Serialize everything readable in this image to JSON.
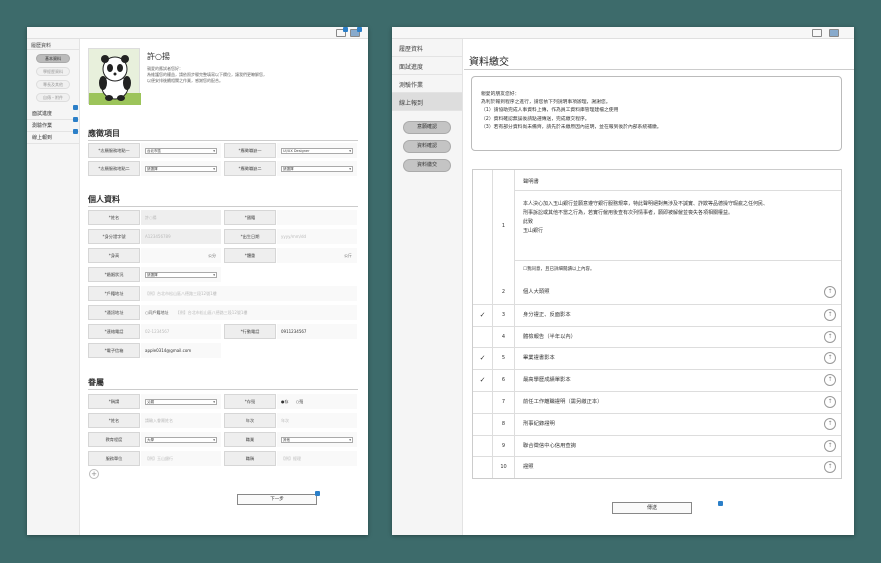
{
  "left": {
    "sidebar": {
      "header": "履歷資料",
      "pills": [
        "基本資料",
        "學經歷資料",
        "專長及其他",
        "自傳・附件"
      ],
      "nav": [
        "面試進度",
        "測驗作業",
        "線上報到"
      ]
    },
    "profile": {
      "name": "許○揚",
      "intro": [
        "親愛的應試者您好：",
        "為維護您的權益，請依照步驟完整填寫以下欄位，讓我們更瞭解您，",
        "以便安排後續相關之作業，感謝您的配合。"
      ]
    },
    "section_jobs": "應徵項目",
    "jobs": [
      {
        "label": "*志願服務地點一",
        "value": "台北市區"
      },
      {
        "label": "*應徵職缺一",
        "value": "UI/UX Designer"
      },
      {
        "label": "*志願服務地點二",
        "value": "請選擇"
      },
      {
        "label": "*應徵職缺二",
        "value": "請選擇"
      }
    ],
    "section_personal": "個人資料",
    "personal": {
      "name_label": "*姓名",
      "name_value": "許○揚",
      "nationality_label": "*國籍",
      "nationality_value": "",
      "id_label": "*身分證字號",
      "id_value": "A123456789",
      "birth_label": "*出生日期",
      "birth_value": "yyyy/mm/dd",
      "height_label": "*身高",
      "height_unit": "公分",
      "weight_label": "*體重",
      "weight_unit": "公斤",
      "marital_label": "*婚姻狀況",
      "marital_value": "請選擇",
      "reg_addr_label": "*戶籍地址",
      "reg_addr_value": "【例】台北市松山區八德路三段12號1樓",
      "mail_addr_label": "*通訊地址",
      "mail_addr_same": "○同戶籍地址",
      "mail_addr_value": "【例】台北市松山區八德路三段12號1樓",
      "phone_label": "*連絡電話",
      "phone_value": "02-1234567",
      "mobile_label": "*行動電話",
      "mobile_value": "0911234567",
      "email_label": "*電子信箱",
      "email_value": "apple0314@gmail.com"
    },
    "section_family": "眷屬",
    "family": {
      "relation_label": "*稱謂",
      "relation_value": "父親",
      "alive_label": "*存歿",
      "alive_yes": "●存",
      "alive_no": "○歿",
      "name_label": "*姓名",
      "name_value": "請輸入眷屬姓名",
      "age_label": "年次",
      "age_value": "年次",
      "edu_label": "教育程度",
      "edu_value": "大學",
      "job_label": "職業",
      "job_value": "其他",
      "company_label": "服務單位",
      "company_value": "【例】玉山銀行",
      "title_label": "職稱",
      "title_value": "【例】經理"
    },
    "add_icon": "+",
    "next_button": "下一步"
  },
  "right": {
    "sidebar": {
      "nav": [
        "履歷資料",
        "面試進度",
        "測驗作業",
        "線上報到"
      ],
      "pills": [
        "意願確認",
        "資料確認",
        "資料繳交"
      ]
    },
    "title": "資料繳交",
    "notice": [
      "親愛的朋友您好：",
      "為利於報到程序之進行，請您依下列說明事項辦理，謝謝您。",
      "（1）請協助完成人事資料上傳，作為員工資料庫管理建檔之使用",
      "（2）資料確認無誤後請點選傳送，完成繳交程序。",
      "（3）若有部分資料尚未備齊，請先於未繳原因內註明，並在報到後於內部系統補繳。"
    ],
    "declaration": {
      "num": "1",
      "title": "聲明書",
      "body": [
        "本人決心加入玉山銀行並願意遵守銀行服務規章，特此聲明絕對無涉及不誠實、詐欺等品德操守瑕疵之任何民、",
        "刑事訴訟或其他不當之行為，若實行僱用後查有次列情事者，願即被解僱並喪失各項相關權益。"
      ],
      "closing": "此致",
      "to": "玉山銀行",
      "agree": "☐我同意，且已詳細閱讀以上內容。"
    },
    "items": [
      {
        "num": "2",
        "text": "個人大頭照",
        "check": ""
      },
      {
        "num": "3",
        "text": "身分證正、反面影本",
        "check": "✓"
      },
      {
        "num": "4",
        "text": "體檢報告（半年以內）",
        "check": ""
      },
      {
        "num": "5",
        "text": "畢業證書影本",
        "check": "✓"
      },
      {
        "num": "6",
        "text": "最高學歷成績單影本",
        "check": "✓"
      },
      {
        "num": "7",
        "text": "前任工作離職證明（需另繳正本）",
        "check": ""
      },
      {
        "num": "8",
        "text": "刑事紀錄證明",
        "check": ""
      },
      {
        "num": "9",
        "text": "聯合徵信中心信用查詢",
        "check": ""
      },
      {
        "num": "10",
        "text": "證照",
        "check": ""
      }
    ],
    "upload_icon": "↑",
    "submit_button": "傳送"
  },
  "colors": {
    "background": "#3d6b6b",
    "badge": "#2b7fc8"
  }
}
